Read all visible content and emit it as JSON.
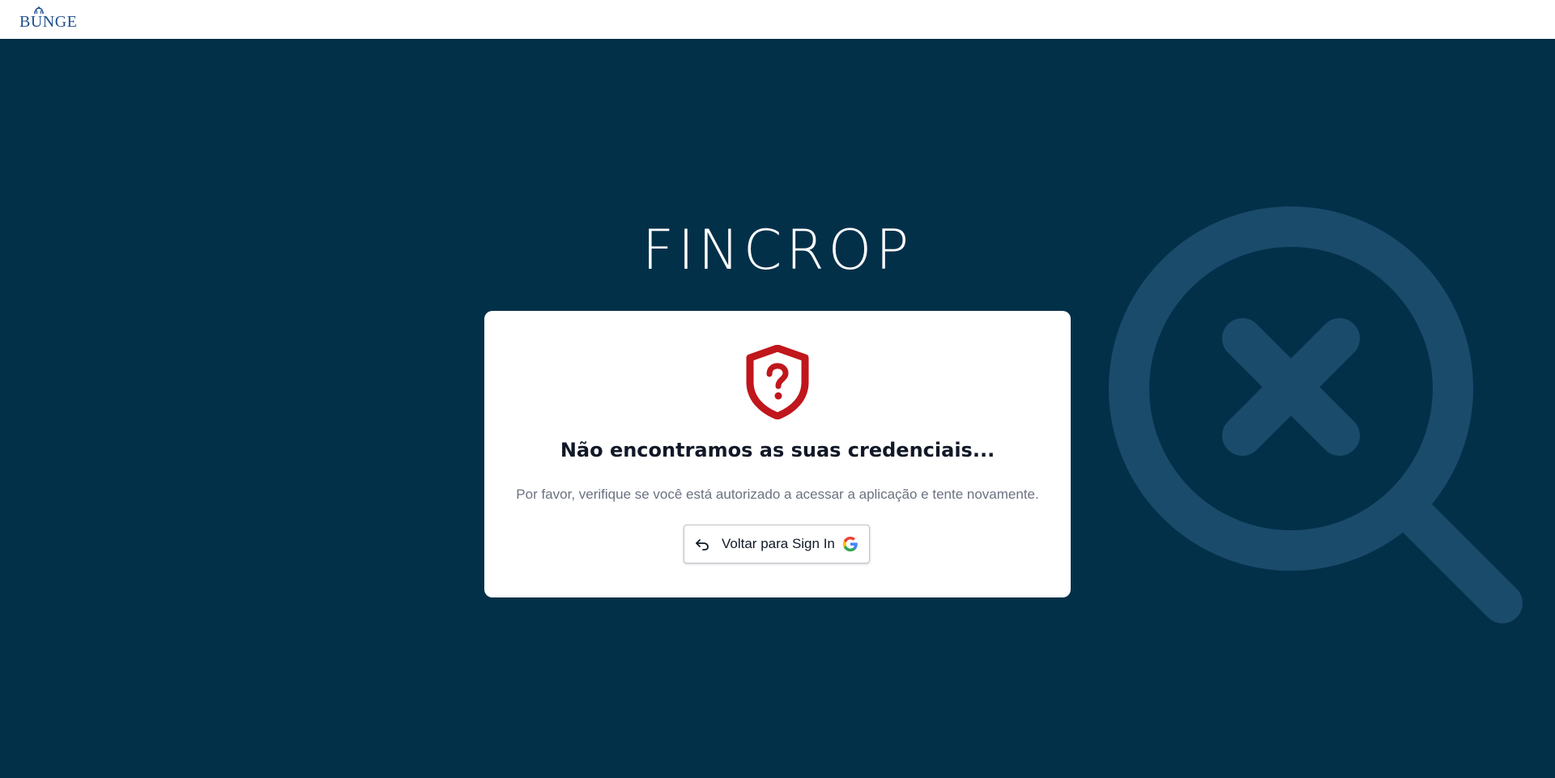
{
  "header": {
    "brand_text": "BUNGE",
    "brand_color": "#1d4f8c"
  },
  "page": {
    "background_color": "#033049",
    "app_title": "FINCROP"
  },
  "card": {
    "icon": "shield-question-icon",
    "icon_color": "#c0161c",
    "title": "Não encontramos as suas credenciais...",
    "message": "Por favor, verifique se você está autorizado a acessar a aplicação e tente novamente.",
    "button": {
      "label": "Voltar para Sign In",
      "icon_left": "undo-arrow-icon",
      "icon_right": "google-icon"
    }
  },
  "decoration": {
    "icon": "search-x-icon",
    "color": "#1a4b6b"
  }
}
